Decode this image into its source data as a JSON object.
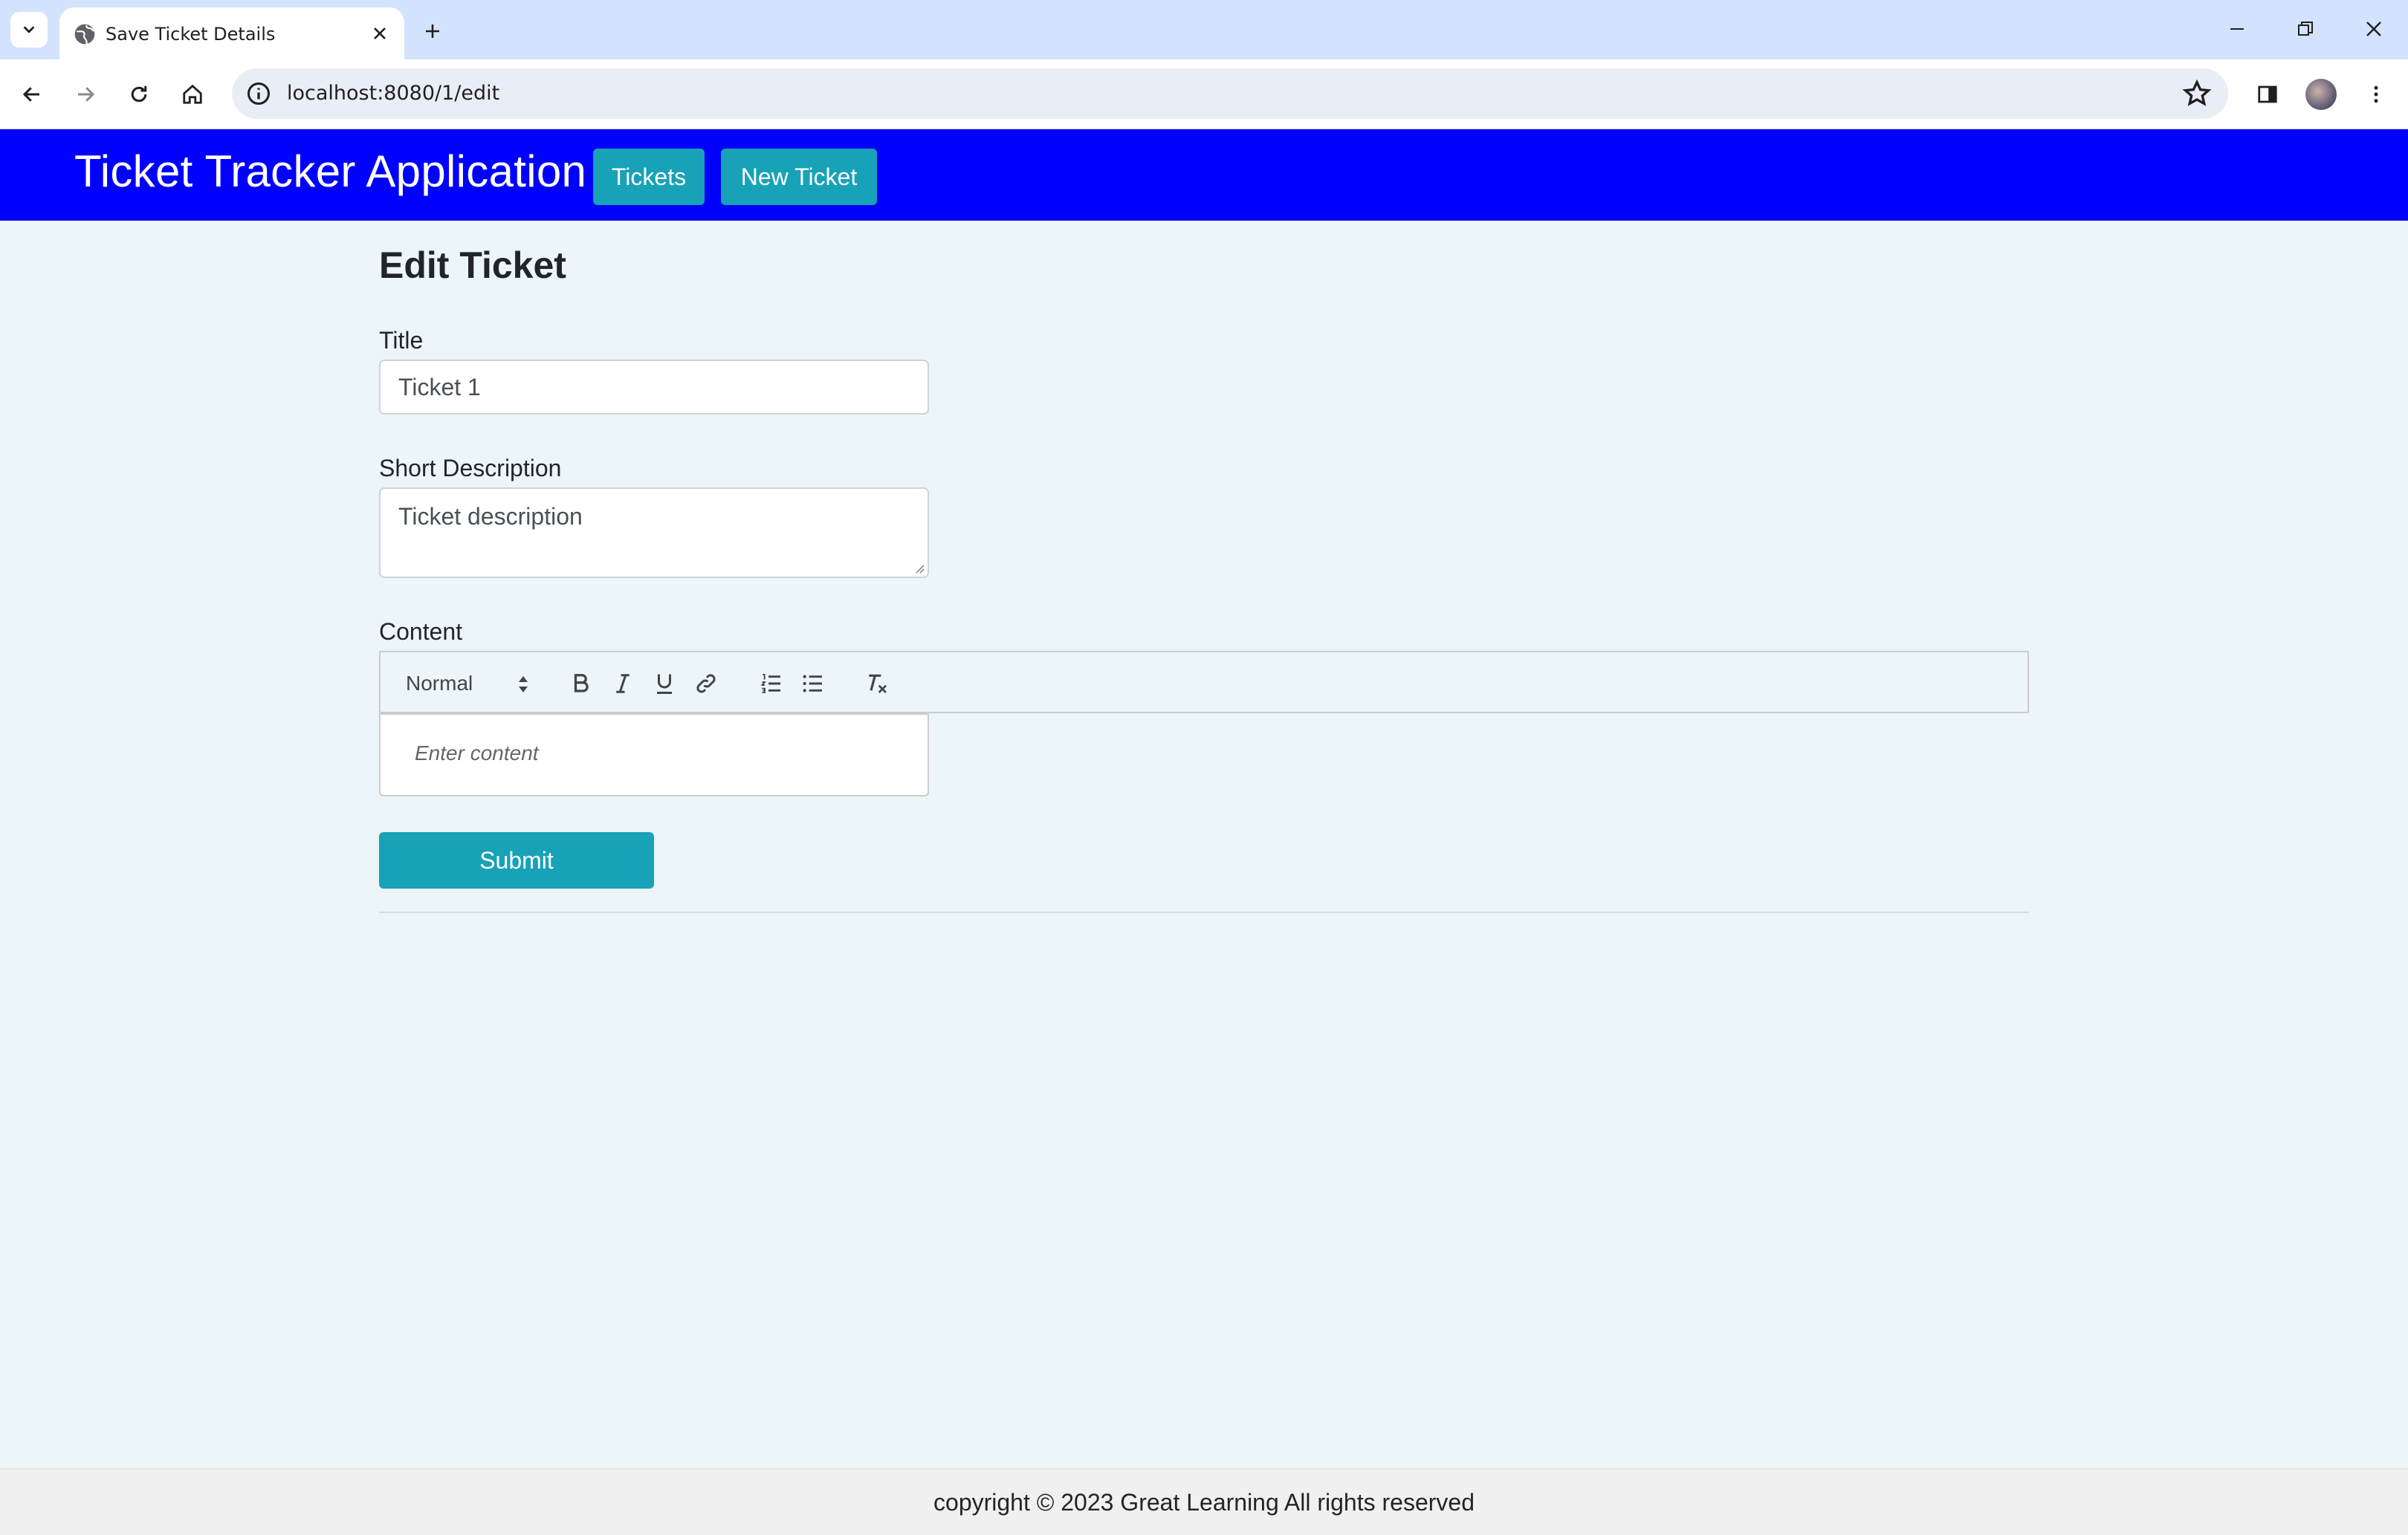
{
  "browser": {
    "tab_title": "Save Ticket Details",
    "url": "localhost:8080/1/edit"
  },
  "navbar": {
    "brand": "Ticket Tracker Application",
    "tickets_label": "Tickets",
    "new_ticket_label": "New Ticket",
    "color": "#0000ff",
    "button_color": "#17a2b8"
  },
  "form": {
    "heading": "Edit Ticket",
    "title_label": "Title",
    "title_value": "Ticket 1",
    "short_description_label": "Short Description",
    "short_description_value": "Ticket description",
    "content_label": "Content",
    "editor": {
      "header_select_value": "Normal",
      "tools": [
        "bold-icon",
        "italic-icon",
        "underline-icon",
        "link-icon",
        "ordered-list-icon",
        "bullet-list-icon",
        "clear-format-icon"
      ],
      "placeholder": "Enter content"
    },
    "submit_label": "Submit"
  },
  "footer": {
    "text": "copyright © 2023 Great Learning All rights reserved"
  }
}
